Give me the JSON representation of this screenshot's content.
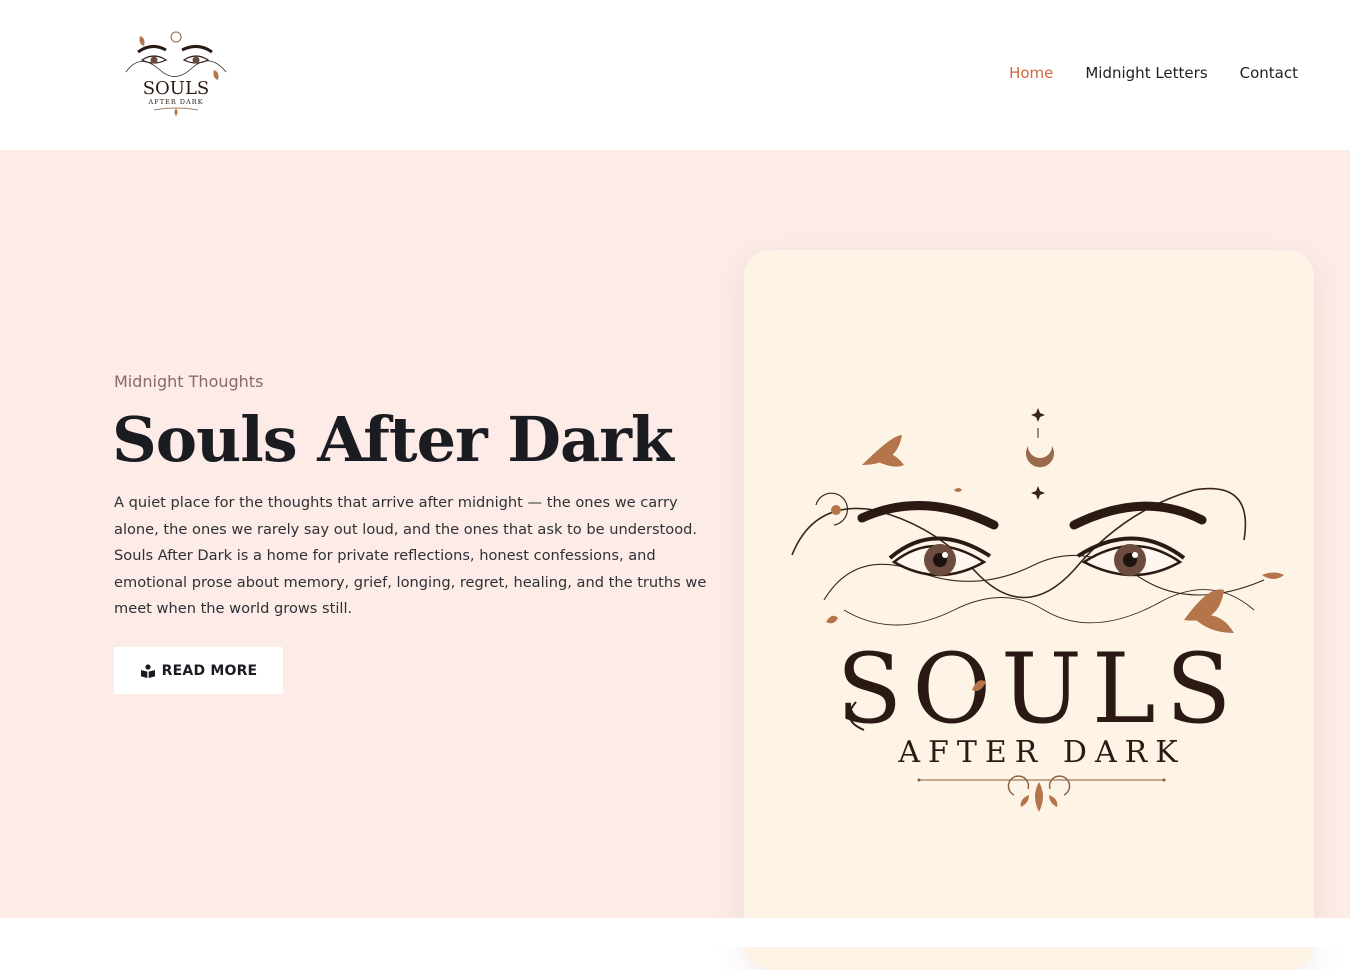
{
  "header": {
    "logo_text_main": "SOULS",
    "logo_text_sub": "AFTER DARK",
    "nav": [
      {
        "label": "Home",
        "active": true
      },
      {
        "label": "Midnight Letters",
        "active": false
      },
      {
        "label": "Contact",
        "active": false
      }
    ]
  },
  "hero": {
    "eyebrow": "Midnight Thoughts",
    "title": "Souls After Dark",
    "description": "A quiet place for the thoughts that arrive after midnight — the ones we carry alone, the ones we rarely say out loud, and the ones that ask to be understood. Souls After Dark is a home for private reflections, honest confessions, and emotional prose about memory, grief, longing, regret, healing, and the truths we meet when the world grows still.",
    "button_label": "READ MORE",
    "button_icon": "reader-book-icon"
  },
  "artwork": {
    "main_text": "SOULS",
    "sub_text": "AFTER DARK"
  },
  "colors": {
    "accent": "#d3673f",
    "hero_bg": "#fcebe7",
    "card_bg": "#fdf4e6",
    "ink": "#3a241c",
    "leaf": "#b5754b"
  }
}
